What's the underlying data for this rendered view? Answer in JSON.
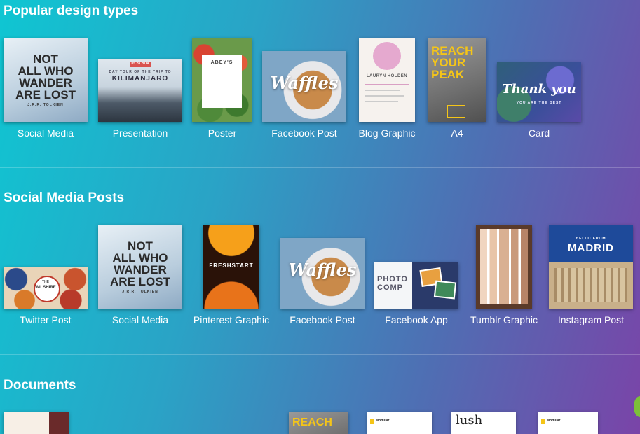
{
  "sections": [
    {
      "title": "Popular design types",
      "items": [
        {
          "label": "Social Media",
          "art": [
            "NOT",
            "ALL WHO",
            "WANDER",
            "ARE LOST",
            "J.R.R. TOLKIEN"
          ]
        },
        {
          "label": "Presentation",
          "art": [
            "05.28.2014",
            "DAY TOUR OF THE TRIP TO",
            "KILIMANJARO"
          ]
        },
        {
          "label": "Poster",
          "art": [
            "ABEY'S"
          ]
        },
        {
          "label": "Facebook Post",
          "art": [
            "Waffles"
          ]
        },
        {
          "label": "Blog Graphic",
          "art": [
            "LAURYN HOLDEN"
          ]
        },
        {
          "label": "A4",
          "art": [
            "REACH",
            "YOUR",
            "PEAK"
          ]
        },
        {
          "label": "Card",
          "art": [
            "Thank you",
            "YOU ARE THE BEST"
          ]
        }
      ]
    },
    {
      "title": "Social Media Posts",
      "items": [
        {
          "label": "Twitter Post",
          "art": [
            "THE",
            "WILSHIRE"
          ]
        },
        {
          "label": "Social Media",
          "art": [
            "NOT",
            "ALL WHO",
            "WANDER",
            "ARE LOST",
            "J.R.R. TOLKIEN"
          ]
        },
        {
          "label": "Pinterest Graphic",
          "art": [
            "FRESHSTART"
          ]
        },
        {
          "label": "Facebook Post",
          "art": [
            "Waffles"
          ]
        },
        {
          "label": "Facebook App",
          "art": [
            "PHOTO",
            "COMP"
          ]
        },
        {
          "label": "Tumblr Graphic",
          "art": []
        },
        {
          "label": "Instagram Post",
          "art": [
            "HELLO FROM",
            "MADRID"
          ]
        }
      ]
    },
    {
      "title": "Documents",
      "items": [
        {
          "label": "",
          "art": []
        },
        {
          "label": "",
          "art": [
            "REACH"
          ]
        },
        {
          "label": "",
          "art": [
            "Modular"
          ]
        },
        {
          "label": "",
          "art": [
            "lush"
          ]
        },
        {
          "label": "",
          "art": [
            "Modular"
          ]
        }
      ]
    }
  ]
}
